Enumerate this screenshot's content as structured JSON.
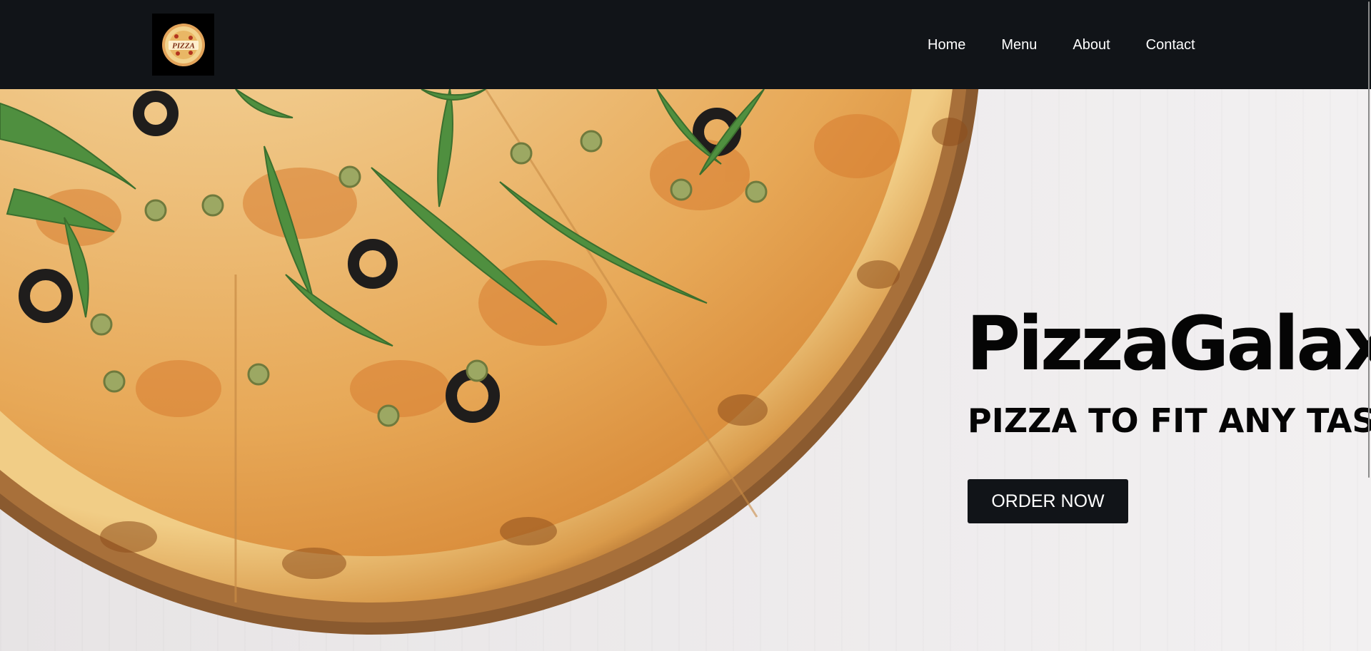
{
  "nav": {
    "logo_text": "PIZZA",
    "links": [
      "Home",
      "Menu",
      "About",
      "Contact"
    ]
  },
  "hero": {
    "title": "PizzaGalaxy",
    "tagline": "PIZZA TO FIT ANY TASTE",
    "cta_label": "ORDER NOW",
    "image": "pizza-photo"
  },
  "colors": {
    "nav_bg": "#111418",
    "button_bg": "#111418",
    "text": "#050505",
    "link": "#ffffff"
  }
}
